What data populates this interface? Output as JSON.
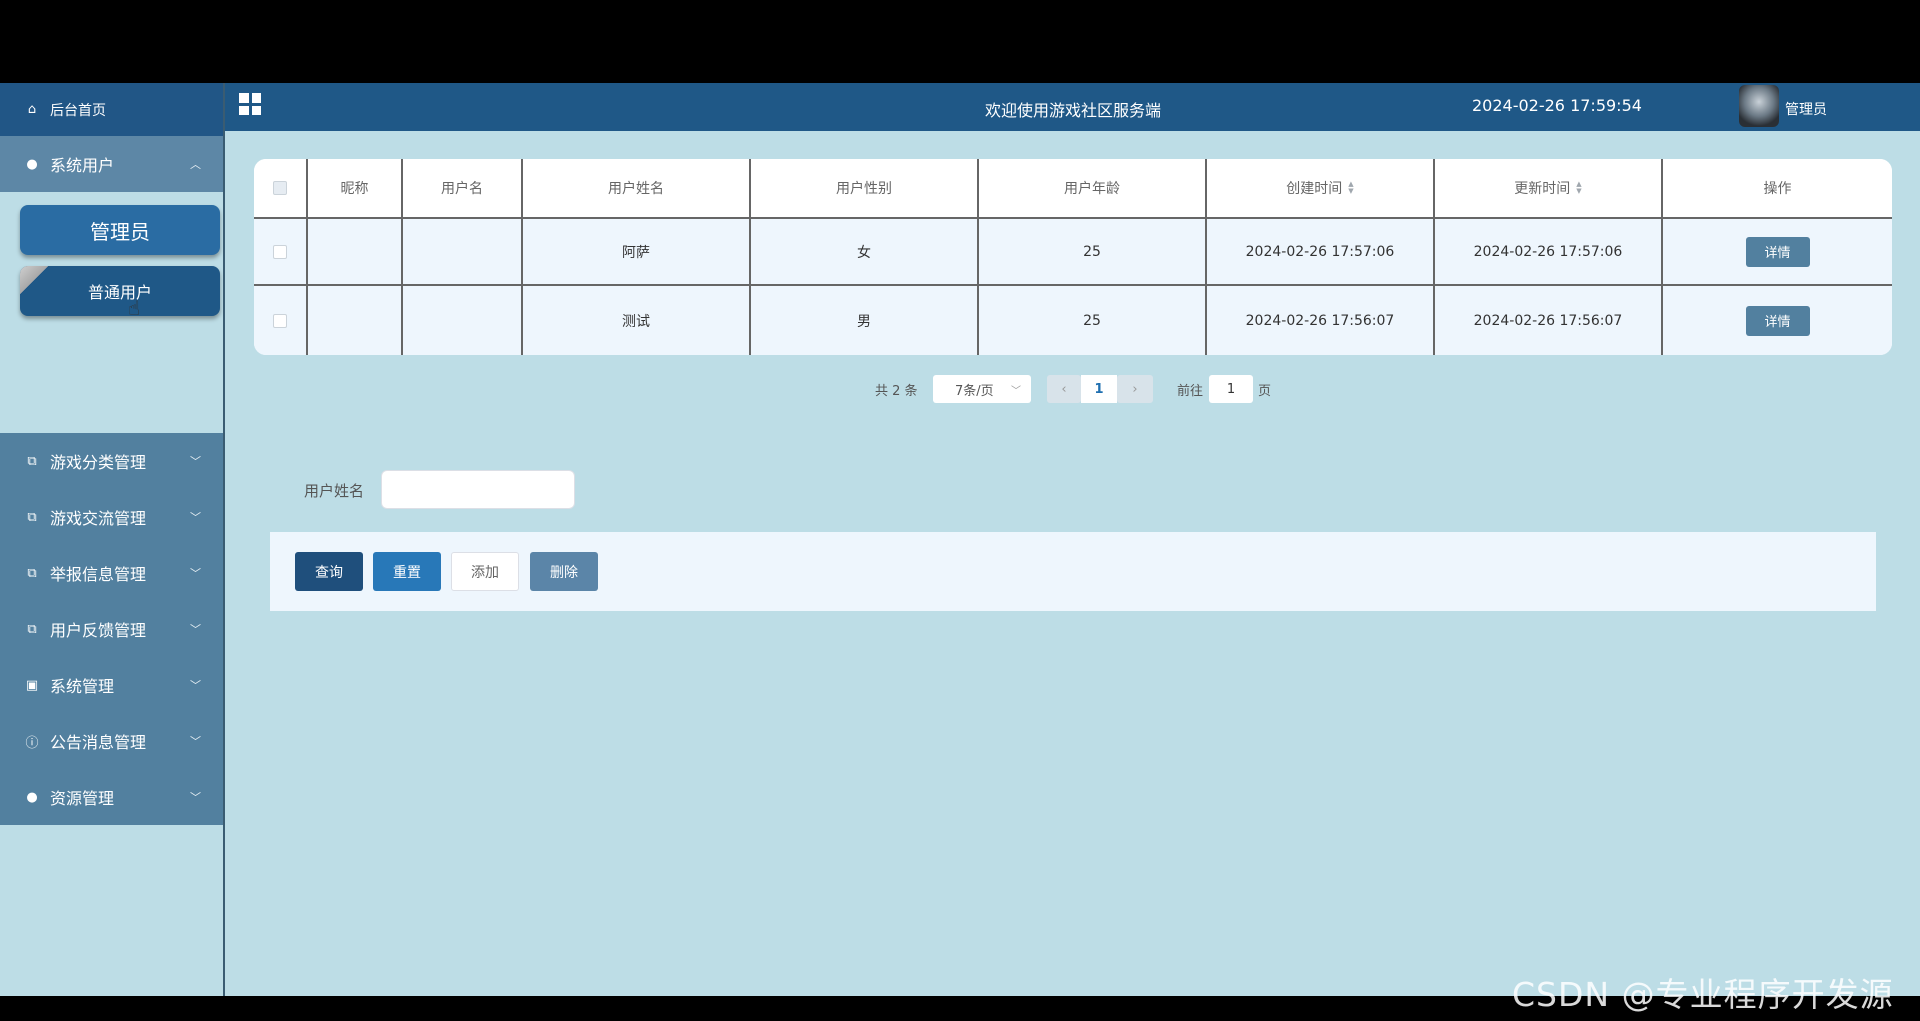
{
  "sidebar": {
    "home": "后台首页",
    "open_group": "系统用户",
    "sub_admin": "管理员",
    "sub_user": "普通用户",
    "groups": [
      {
        "label": "游戏分类管理",
        "icon": "external-link-icon"
      },
      {
        "label": "游戏交流管理",
        "icon": "external-link-icon"
      },
      {
        "label": "举报信息管理",
        "icon": "external-link-icon"
      },
      {
        "label": "用户反馈管理",
        "icon": "external-link-icon"
      },
      {
        "label": "系统管理",
        "icon": "picture-icon"
      },
      {
        "label": "公告消息管理",
        "icon": "info-circle-icon"
      },
      {
        "label": "资源管理",
        "icon": "bulb-icon"
      }
    ]
  },
  "header": {
    "title": "欢迎使用游戏社区服务端",
    "datetime": "2024-02-26 17:59:54",
    "user": "管理员"
  },
  "table": {
    "columns": [
      "昵称",
      "用户名",
      "用户姓名",
      "用户性别",
      "用户年龄",
      "创建时间",
      "更新时间",
      "操作"
    ],
    "rows": [
      {
        "nickname": "",
        "username": "",
        "name": "阿萨",
        "gender": "女",
        "age": "25",
        "created": "2024-02-26 17:57:06",
        "updated": "2024-02-26 17:57:06",
        "action": "详情"
      },
      {
        "nickname": "",
        "username": "",
        "name": "测试",
        "gender": "男",
        "age": "25",
        "created": "2024-02-26 17:56:07",
        "updated": "2024-02-26 17:56:07",
        "action": "详情"
      }
    ]
  },
  "pagination": {
    "total": "共 2 条",
    "page_size": "7条/页",
    "current": "1",
    "goto_label": "前往",
    "goto_value": "1",
    "page_suffix": "页"
  },
  "search": {
    "label": "用户姓名",
    "value": ""
  },
  "actions": {
    "query": "查询",
    "reset": "重置",
    "add": "添加",
    "delete": "删除"
  },
  "watermark": "CSDN @专业程序开发源"
}
